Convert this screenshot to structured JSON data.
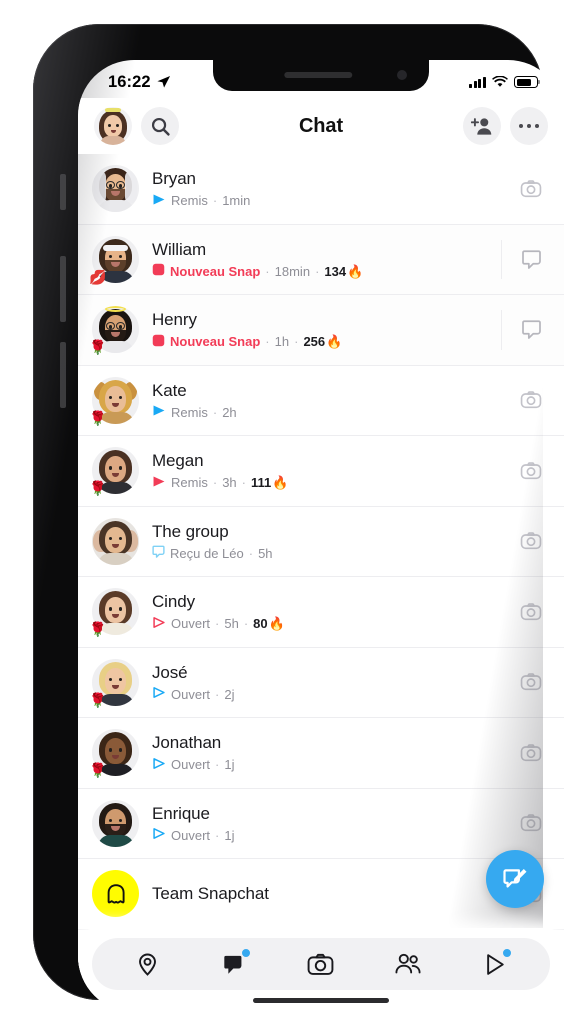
{
  "status_bar": {
    "time": "16:22",
    "location_icon": "location-arrow-icon",
    "signal_icon": "cellular-bars-icon",
    "wifi_icon": "wifi-icon",
    "battery_icon": "battery-icon"
  },
  "header": {
    "title": "Chat",
    "profile_icon": "profile-bitmoji-avatar",
    "search_icon": "search-icon",
    "add_friend_icon": "add-friend-icon",
    "more_icon": "more-options-icon"
  },
  "chats": [
    {
      "name": "Bryan",
      "status": "Remis",
      "status_type": "delivered",
      "status_color": "#19a9f5",
      "status_icon": "arrow-filled-icon",
      "time": "1min",
      "streak": "",
      "action_icon": "camera-icon",
      "unread": false,
      "badge": "",
      "avatar_kind": "bryan"
    },
    {
      "name": "William",
      "status": "Nouveau Snap",
      "status_type": "new-snap",
      "status_color": "#f23c57",
      "status_icon": "snap-square-icon",
      "time": "18min",
      "streak": "134",
      "action_icon": "chat-bubble-icon",
      "unread": true,
      "badge": "💋",
      "avatar_kind": "william"
    },
    {
      "name": "Henry",
      "status": "Nouveau Snap",
      "status_type": "new-snap",
      "status_color": "#f23c57",
      "status_icon": "snap-square-icon",
      "time": "1h",
      "streak": "256",
      "action_icon": "chat-bubble-icon",
      "unread": true,
      "badge": "🌹",
      "avatar_kind": "henry"
    },
    {
      "name": "Kate",
      "status": "Remis",
      "status_type": "delivered",
      "status_color": "#19a9f5",
      "status_icon": "arrow-filled-icon",
      "time": "2h",
      "streak": "",
      "action_icon": "camera-icon",
      "unread": false,
      "badge": "🌹",
      "avatar_kind": "kate"
    },
    {
      "name": "Megan",
      "status": "Remis",
      "status_type": "delivered",
      "status_color": "#f23c57",
      "status_icon": "arrow-filled-icon",
      "time": "3h",
      "streak": "111",
      "action_icon": "camera-icon",
      "unread": false,
      "badge": "🌹",
      "avatar_kind": "megan"
    },
    {
      "name": "The group",
      "status": "Reçu de Léo",
      "status_type": "received-chat",
      "status_color": "#7fd1f5",
      "status_icon": "chat-bubble-outline-icon",
      "time": "5h",
      "streak": "",
      "action_icon": "camera-icon",
      "unread": false,
      "badge": "",
      "avatar_kind": "group"
    },
    {
      "name": "Cindy",
      "status": "Ouvert",
      "status_type": "opened",
      "status_color": "#f23c57",
      "status_icon": "arrow-outline-icon",
      "time": "5h",
      "streak": "80",
      "action_icon": "camera-icon",
      "unread": false,
      "badge": "🌹",
      "avatar_kind": "cindy"
    },
    {
      "name": "José",
      "status": "Ouvert",
      "status_type": "opened",
      "status_color": "#19a9f5",
      "status_icon": "arrow-outline-icon",
      "time": "2j",
      "streak": "",
      "action_icon": "camera-icon",
      "unread": false,
      "badge": "🌹",
      "avatar_kind": "jose"
    },
    {
      "name": "Jonathan",
      "status": "Ouvert",
      "status_type": "opened",
      "status_color": "#19a9f5",
      "status_icon": "arrow-outline-icon",
      "time": "1j",
      "streak": "",
      "action_icon": "camera-icon",
      "unread": false,
      "badge": "🌹",
      "avatar_kind": "jonathan"
    },
    {
      "name": "Enrique",
      "status": "Ouvert",
      "status_type": "opened",
      "status_color": "#19a9f5",
      "status_icon": "arrow-outline-icon",
      "time": "1j",
      "streak": "",
      "action_icon": "camera-icon",
      "unread": false,
      "badge": "",
      "avatar_kind": "enrique"
    },
    {
      "name": "Team Snapchat",
      "status": "",
      "status_type": "",
      "status_color": "",
      "status_icon": "",
      "time": "",
      "streak": "",
      "action_icon": "camera-icon",
      "unread": false,
      "badge": "",
      "avatar_kind": "team"
    }
  ],
  "fab": {
    "icon": "new-chat-icon",
    "color": "#36a9f0"
  },
  "bottom_nav": {
    "items": [
      {
        "icon": "map-pin-icon",
        "active": false,
        "badge": false
      },
      {
        "icon": "chat-filled-icon",
        "active": true,
        "badge": true
      },
      {
        "icon": "camera-icon",
        "active": false,
        "badge": false
      },
      {
        "icon": "friends-icon",
        "active": false,
        "badge": false
      },
      {
        "icon": "spotlight-play-icon",
        "active": false,
        "badge": true
      }
    ],
    "home_indicator": "home-indicator"
  },
  "colors": {
    "accent_blue": "#36a9f0",
    "snap_red": "#f23c57",
    "snap_yellow": "#FFFC00",
    "nav_bg": "#f1f1f3"
  }
}
